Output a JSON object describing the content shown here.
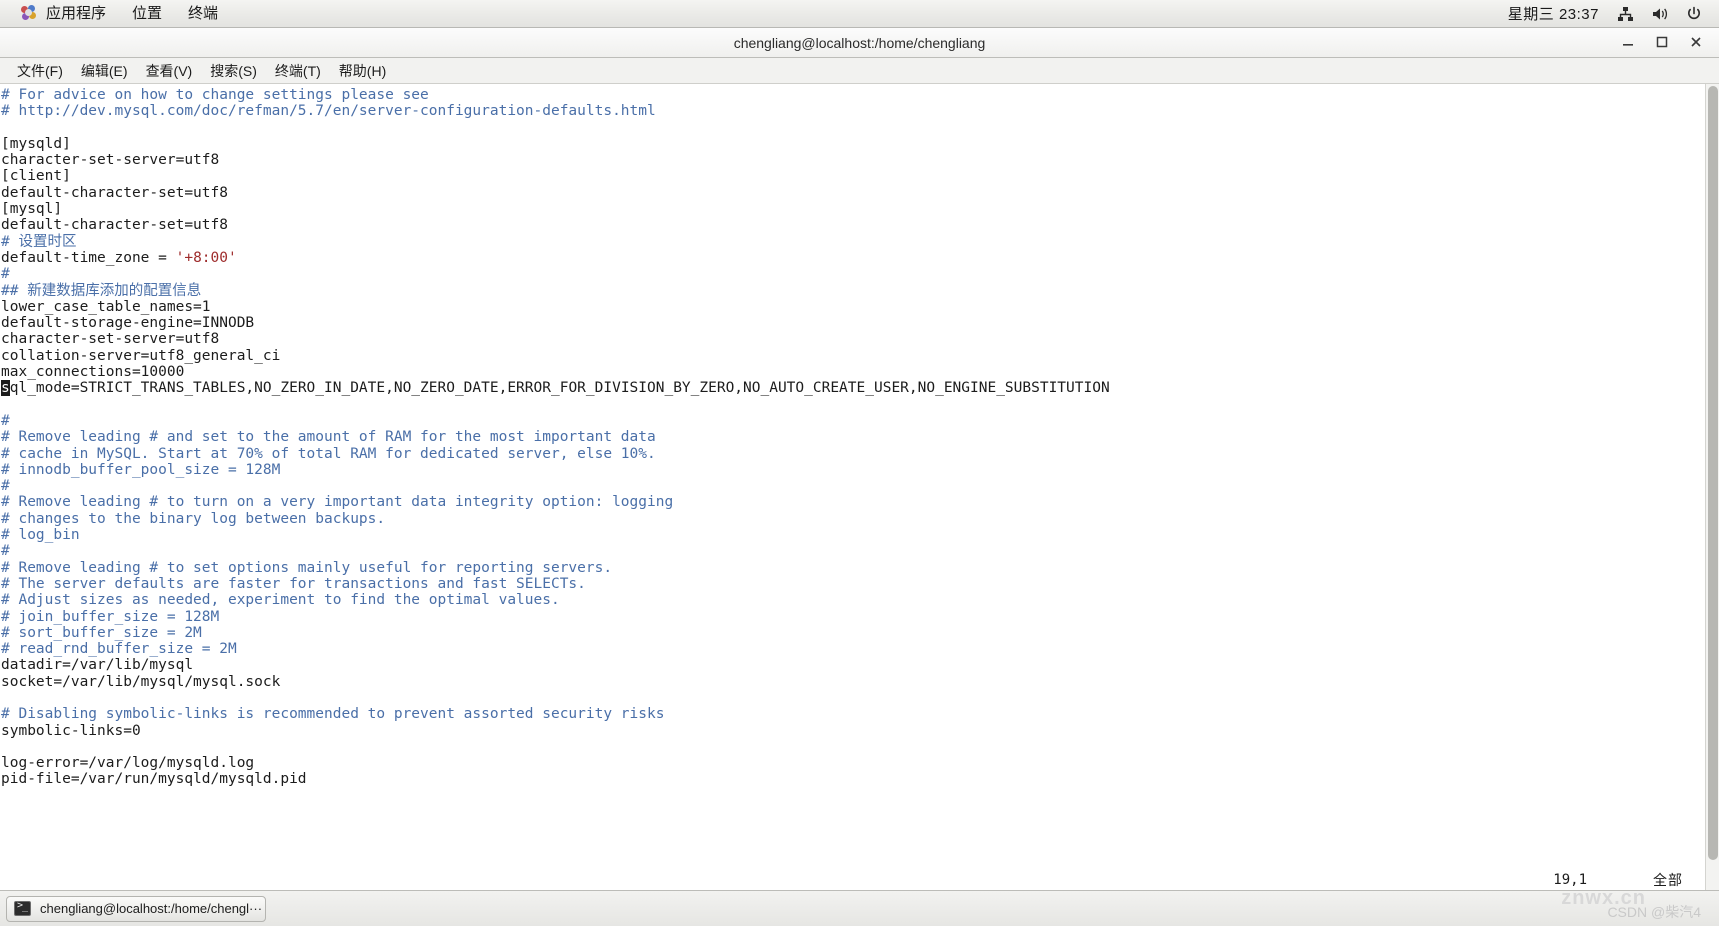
{
  "panel": {
    "logo_icon": "gnome-footprint-icon",
    "menus": [
      {
        "label": "应用程序",
        "name": "panel-menu-applications"
      },
      {
        "label": "位置",
        "name": "panel-menu-places"
      },
      {
        "label": "终端",
        "name": "panel-menu-terminal"
      }
    ],
    "clock": "星期三 23:37",
    "tray": [
      {
        "icon": "network-icon"
      },
      {
        "icon": "volume-icon"
      },
      {
        "icon": "power-icon"
      }
    ]
  },
  "window": {
    "title": "chengliang@localhost:/home/chengliang",
    "buttons": {
      "minimize": "minimize-button",
      "maximize": "maximize-button",
      "close": "close-button"
    }
  },
  "menubar": [
    {
      "label": "文件(F)",
      "name": "menu-file"
    },
    {
      "label": "编辑(E)",
      "name": "menu-edit"
    },
    {
      "label": "查看(V)",
      "name": "menu-view"
    },
    {
      "label": "搜索(S)",
      "name": "menu-search"
    },
    {
      "label": "终端(T)",
      "name": "menu-terminal"
    },
    {
      "label": "帮助(H)",
      "name": "menu-help"
    }
  ],
  "terminal": {
    "lines": [
      {
        "type": "comment",
        "text": "# For advice on how to change settings please see"
      },
      {
        "type": "comment",
        "text": "# http://dev.mysql.com/doc/refman/5.7/en/server-configuration-defaults.html"
      },
      {
        "type": "blank",
        "text": ""
      },
      {
        "type": "plain",
        "text": "[mysqld]"
      },
      {
        "type": "plain",
        "text": "character-set-server=utf8"
      },
      {
        "type": "plain",
        "text": "[client]"
      },
      {
        "type": "plain",
        "text": "default-character-set=utf8"
      },
      {
        "type": "plain",
        "text": "[mysql]"
      },
      {
        "type": "plain",
        "text": "default-character-set=utf8"
      },
      {
        "type": "comment",
        "text": "# 设置时区"
      },
      {
        "type": "string-line",
        "prefix": "default-time_zone = ",
        "value": "'+8:00'"
      },
      {
        "type": "comment",
        "text": "#"
      },
      {
        "type": "comment",
        "text": "## 新建数据库添加的配置信息"
      },
      {
        "type": "plain",
        "text": "lower_case_table_names=1"
      },
      {
        "type": "plain",
        "text": "default-storage-engine=INNODB"
      },
      {
        "type": "plain",
        "text": "character-set-server=utf8"
      },
      {
        "type": "plain",
        "text": "collation-server=utf8_general_ci"
      },
      {
        "type": "plain",
        "text": "max_connections=10000"
      },
      {
        "type": "cursor-line",
        "cursor_char": "s",
        "text": "ql_mode=STRICT_TRANS_TABLES,NO_ZERO_IN_DATE,NO_ZERO_DATE,ERROR_FOR_DIVISION_BY_ZERO,NO_AUTO_CREATE_USER,NO_ENGINE_SUBSTITUTION"
      },
      {
        "type": "blank",
        "text": ""
      },
      {
        "type": "comment",
        "text": "#"
      },
      {
        "type": "comment",
        "text": "# Remove leading # and set to the amount of RAM for the most important data"
      },
      {
        "type": "comment",
        "text": "# cache in MySQL. Start at 70% of total RAM for dedicated server, else 10%."
      },
      {
        "type": "comment",
        "text": "# innodb_buffer_pool_size = 128M"
      },
      {
        "type": "comment",
        "text": "#"
      },
      {
        "type": "comment",
        "text": "# Remove leading # to turn on a very important data integrity option: logging"
      },
      {
        "type": "comment",
        "text": "# changes to the binary log between backups."
      },
      {
        "type": "comment",
        "text": "# log_bin"
      },
      {
        "type": "comment",
        "text": "#"
      },
      {
        "type": "comment",
        "text": "# Remove leading # to set options mainly useful for reporting servers."
      },
      {
        "type": "comment",
        "text": "# The server defaults are faster for transactions and fast SELECTs."
      },
      {
        "type": "comment",
        "text": "# Adjust sizes as needed, experiment to find the optimal values."
      },
      {
        "type": "comment",
        "text": "# join_buffer_size = 128M"
      },
      {
        "type": "comment",
        "text": "# sort_buffer_size = 2M"
      },
      {
        "type": "comment",
        "text": "# read_rnd_buffer_size = 2M"
      },
      {
        "type": "plain",
        "text": "datadir=/var/lib/mysql"
      },
      {
        "type": "plain",
        "text": "socket=/var/lib/mysql/mysql.sock"
      },
      {
        "type": "blank",
        "text": ""
      },
      {
        "type": "comment",
        "text": "# Disabling symbolic-links is recommended to prevent assorted security risks"
      },
      {
        "type": "plain",
        "text": "symbolic-links=0"
      },
      {
        "type": "blank",
        "text": ""
      },
      {
        "type": "plain",
        "text": "log-error=/var/log/mysqld.log"
      },
      {
        "type": "plain",
        "text": "pid-file=/var/run/mysqld/mysqld.pid"
      }
    ],
    "status": {
      "position": "19,1",
      "scroll": "全部"
    },
    "colors": {
      "comment": "#4a6fa8",
      "string": "#9e2b2b",
      "foreground": "#1c1c1c",
      "background": "#ffffff"
    }
  },
  "taskbar": {
    "task_label": "chengliang@localhost:/home/chengl···",
    "task_icon": "terminal-icon"
  },
  "watermarks": {
    "site": "znwx.cn",
    "csdn": "CSDN @柴汽4"
  }
}
